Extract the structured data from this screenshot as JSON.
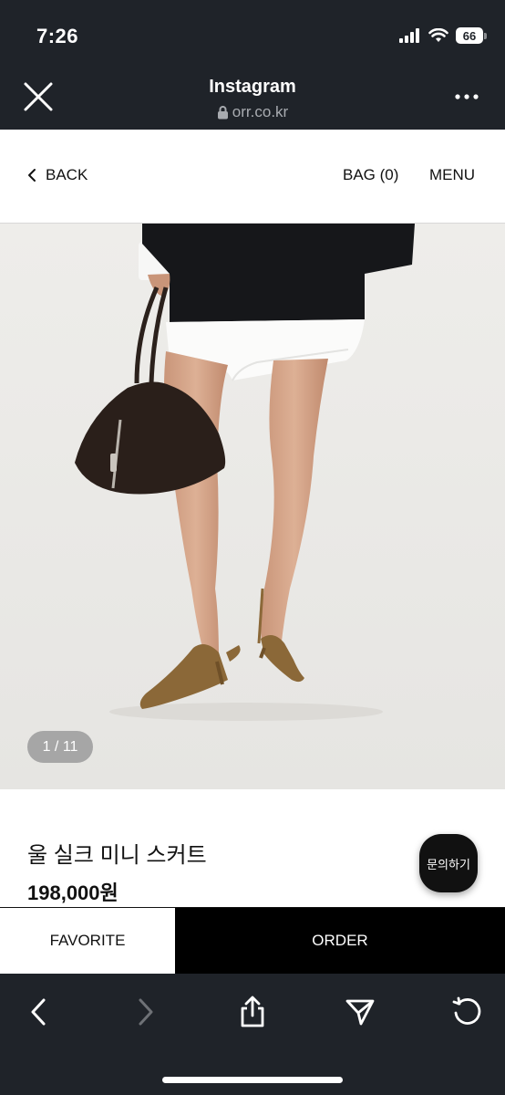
{
  "status_bar": {
    "time": "7:26",
    "battery": "66",
    "icons": [
      "signal-icon",
      "wifi-icon",
      "battery-icon"
    ]
  },
  "browser": {
    "title": "Instagram",
    "url": "orr.co.kr",
    "close_icon": "close-icon",
    "more_icon": "more-icon"
  },
  "header": {
    "back_label": "BACK",
    "bag_label": "BAG (0)",
    "menu_label": "MENU"
  },
  "product": {
    "image_counter": "1 / 11",
    "name": "울 실크 미니 스커트",
    "price": "198,000원",
    "inquiry_label": "문의하기"
  },
  "actions": {
    "favorite_label": "FAVORITE",
    "order_label": "ORDER"
  },
  "toolbar": {
    "icons": [
      "back-icon",
      "forward-icon",
      "share-icon",
      "send-icon",
      "reload-icon"
    ]
  },
  "colors": {
    "chrome": "#1f2329",
    "order_bg": "#000000",
    "photo_bg": "#ebeae7"
  }
}
